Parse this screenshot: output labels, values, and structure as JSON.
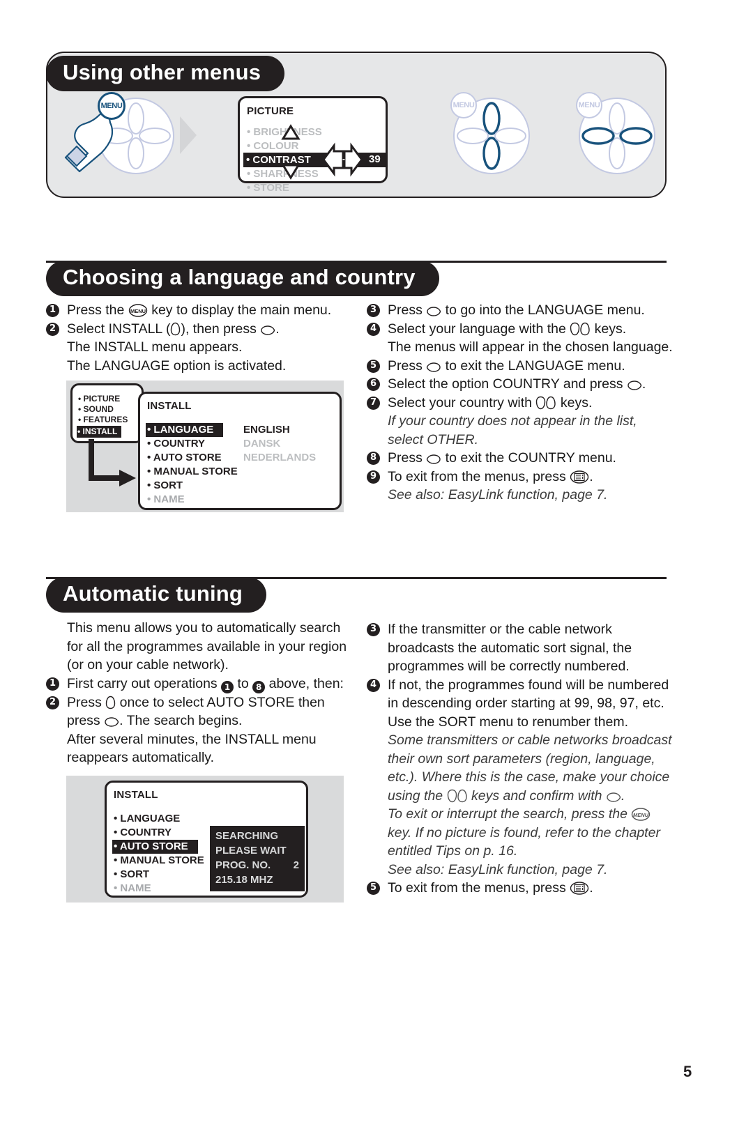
{
  "page": {
    "number": "5"
  },
  "colors": {
    "ink": "#231f20",
    "panel_grey": "#e6e7e8",
    "remote_blue": "#18527c",
    "remote_outline": "#c3c9e2",
    "dim_text": "#bcbec0"
  },
  "section_using_menus": {
    "title": "Using other menus",
    "osd": {
      "title": "PICTURE",
      "items": [
        {
          "label": "BRIGHTNESS",
          "state": "dim"
        },
        {
          "label": "COLOUR",
          "state": "dim"
        },
        {
          "label": "CONTRAST",
          "state": "highlighted"
        },
        {
          "label": "SHARPNESS",
          "state": "dim"
        },
        {
          "label": "STORE",
          "state": "dim"
        }
      ],
      "contrast_scale": "--I--",
      "contrast_value": "39"
    },
    "remotes": [
      {
        "menu_label": "MENU",
        "active_keys": [
          "menu"
        ]
      },
      {
        "menu_label": "MENU",
        "active_keys": [
          "up",
          "down"
        ]
      },
      {
        "menu_label": "MENU",
        "active_keys": [
          "left",
          "right"
        ]
      }
    ]
  },
  "section_language": {
    "title": "Choosing a language and country",
    "left_steps": [
      {
        "n": "1",
        "lines": [
          "Press the [MENU] key to display the main menu."
        ]
      },
      {
        "n": "2",
        "lines": [
          "Select INSTALL ([DOWN]), then press [RIGHT].",
          "The INSTALL menu appears.",
          "The LANGUAGE option is activated."
        ]
      }
    ],
    "right_steps": [
      {
        "n": "3",
        "lines": [
          "Press [RIGHT] to go into the LANGUAGE menu."
        ]
      },
      {
        "n": "4",
        "lines": [
          "Select your language with the [UPDOWN] keys.",
          "The menus will appear in the chosen language."
        ]
      },
      {
        "n": "5",
        "lines": [
          "Press [LEFT] to exit the LANGUAGE menu."
        ]
      },
      {
        "n": "6",
        "lines": [
          "Select the option COUNTRY and press [RIGHT]."
        ]
      },
      {
        "n": "7",
        "lines": [
          "Select your country with [UPDOWN] keys.",
          "If your country does not appear in the list, select OTHER."
        ]
      },
      {
        "n": "8",
        "lines": [
          "Press [LEFT] to exit the COUNTRY menu."
        ]
      },
      {
        "n": "9",
        "lines": [
          "To exit from the menus, press [EXIT].",
          "See also: EasyLink function, page 7."
        ]
      }
    ],
    "osd_main": {
      "items": [
        {
          "label": "PICTURE",
          "state": "normal"
        },
        {
          "label": "SOUND",
          "state": "normal"
        },
        {
          "label": "FEATURES",
          "state": "normal"
        },
        {
          "label": "INSTALL",
          "state": "highlighted"
        }
      ]
    },
    "osd_install": {
      "title": "INSTALL",
      "items": [
        {
          "label": "LANGUAGE",
          "state": "highlighted"
        },
        {
          "label": "COUNTRY",
          "state": "normal"
        },
        {
          "label": "AUTO STORE",
          "state": "normal"
        },
        {
          "label": "MANUAL STORE",
          "state": "normal"
        },
        {
          "label": "SORT",
          "state": "normal"
        },
        {
          "label": "NAME",
          "state": "ghost"
        }
      ],
      "values": [
        {
          "label": "ENGLISH",
          "state": "normal"
        },
        {
          "label": "DANSK",
          "state": "dim"
        },
        {
          "label": "NEDERLANDS",
          "state": "dim"
        }
      ]
    }
  },
  "section_auto_tuning": {
    "title": "Automatic tuning",
    "intro": [
      "This menu allows you to automatically search",
      "for all the programmes available in your region",
      "(or on your cable network)."
    ],
    "left_steps": [
      {
        "n": "1",
        "lines": [
          "First carry out operations [1] to [8] above, then:"
        ]
      },
      {
        "n": "2",
        "lines": [
          "Press [DOWN] once to select AUTO STORE then press [RIGHT]. The search begins.",
          "After several minutes, the INSTALL menu reappears automatically."
        ]
      }
    ],
    "right_steps": [
      {
        "n": "3",
        "lines": [
          "If the transmitter or the cable network broadcasts the automatic sort signal, the programmes will be correctly numbered."
        ]
      },
      {
        "n": "4",
        "lines": [
          "If not, the programmes found will be numbered in descending order starting at 99, 98, 97, etc.",
          "Use the SORT menu to renumber them.",
          "Some transmitters or cable networks broadcast their own sort parameters (region, language, etc.). Where this is the case, make your choice using the [UPDOWN] keys and confirm with [RIGHT].",
          "To exit or interrupt the search, press the [MENU] key. If no picture is found, refer to the chapter entitled Tips on p. 16.",
          "See also: EasyLink function, page 7."
        ]
      },
      {
        "n": "5",
        "lines": [
          "To exit from the menus, press [EXIT]."
        ]
      }
    ],
    "osd_install": {
      "title": "INSTALL",
      "items": [
        {
          "label": "LANGUAGE",
          "state": "normal"
        },
        {
          "label": "COUNTRY",
          "state": "normal"
        },
        {
          "label": "AUTO STORE",
          "state": "highlighted"
        },
        {
          "label": "MANUAL STORE",
          "state": "normal"
        },
        {
          "label": "SORT",
          "state": "normal"
        },
        {
          "label": "NAME",
          "state": "ghost"
        }
      ],
      "search_panel": {
        "line1": "SEARCHING",
        "line2": "PLEASE WAIT",
        "line3_label": "PROG. NO.",
        "line3_value": "2",
        "line4": "215.18 MHZ"
      }
    }
  },
  "icons": {
    "menu": "menu-key-icon",
    "exit": "exit-key-icon",
    "up": "cursor-up-icon",
    "down": "cursor-down-icon",
    "left": "cursor-left-icon",
    "right": "cursor-right-icon"
  }
}
